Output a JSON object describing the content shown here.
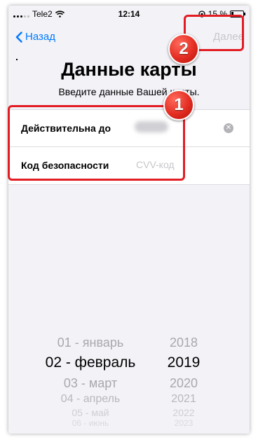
{
  "status_bar": {
    "carrier": "Tele2",
    "time": "12:14",
    "battery_percent": "15 %"
  },
  "nav": {
    "back_label": "Назад",
    "next_label": "Далее"
  },
  "page": {
    "title": "Данные карты",
    "subtitle": "Введите данные Вашей карты."
  },
  "form": {
    "expiry_label": "Действительна до",
    "cvv_label": "Код безопасности",
    "cvv_placeholder": "CVV-код"
  },
  "annotations": {
    "badge_1": "1",
    "badge_2": "2"
  },
  "picker": {
    "months": [
      "01 - январь",
      "02 - февраль",
      "03 - март",
      "04 - апрель",
      "05 - май",
      "06 - июнь"
    ],
    "years": [
      "2018",
      "2019",
      "2020",
      "2021",
      "2022",
      "2023"
    ],
    "selected_month": "02 - февраль",
    "selected_year": "2019"
  },
  "colors": {
    "accent": "#007aff",
    "annotation": "#e31c23",
    "disabled": "#c7c7cc"
  }
}
